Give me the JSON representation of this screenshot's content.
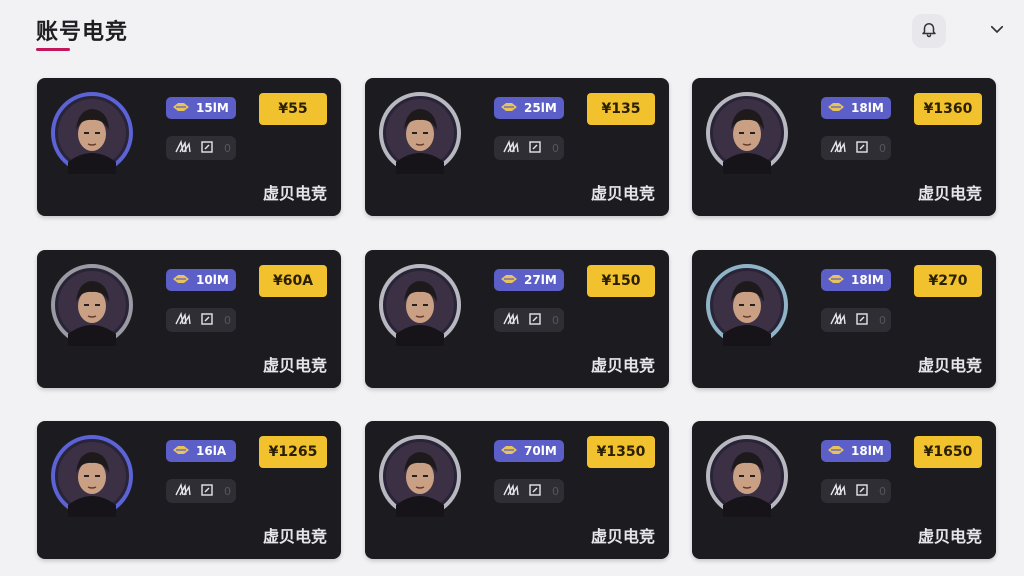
{
  "header": {
    "title": "账号电竞",
    "accent_color": "#c2185b",
    "bell_icon": "bell-icon",
    "menu_icon": "chevron-down-icon"
  },
  "cards": [
    {
      "level": "15lM",
      "price": "¥55",
      "brand": "虚贝电竞",
      "rank_value": "0",
      "ring_color": "#5b63d6"
    },
    {
      "level": "25lM",
      "price": "¥135",
      "brand": "虚贝电竞",
      "rank_value": "0",
      "ring_color": "#b8b8c0"
    },
    {
      "level": "18lM",
      "price": "¥1360",
      "brand": "虚贝电竞",
      "rank_value": "0",
      "ring_color": "#b8b8c0"
    },
    {
      "level": "10lM",
      "price": "¥60A",
      "brand": "虚贝电竞",
      "rank_value": "0",
      "ring_color": "#9a9aa2"
    },
    {
      "level": "27lM",
      "price": "¥150",
      "brand": "虚贝电竞",
      "rank_value": "0",
      "ring_color": "#b8b8c0"
    },
    {
      "level": "18lM",
      "price": "¥270",
      "brand": "虚贝电竞",
      "rank_value": "0",
      "ring_color": "#8fb4c8"
    },
    {
      "level": "16lA",
      "price": "¥1265",
      "brand": "虚贝电竞",
      "rank_value": "0",
      "ring_color": "#5b63d6"
    },
    {
      "level": "70lM",
      "price": "¥1350",
      "brand": "虚贝电竞",
      "rank_value": "0",
      "ring_color": "#b8b8c0"
    },
    {
      "level": "18lM",
      "price": "¥1650",
      "brand": "虚贝电竞",
      "rank_value": "0",
      "ring_color": "#b8b8c0"
    }
  ]
}
